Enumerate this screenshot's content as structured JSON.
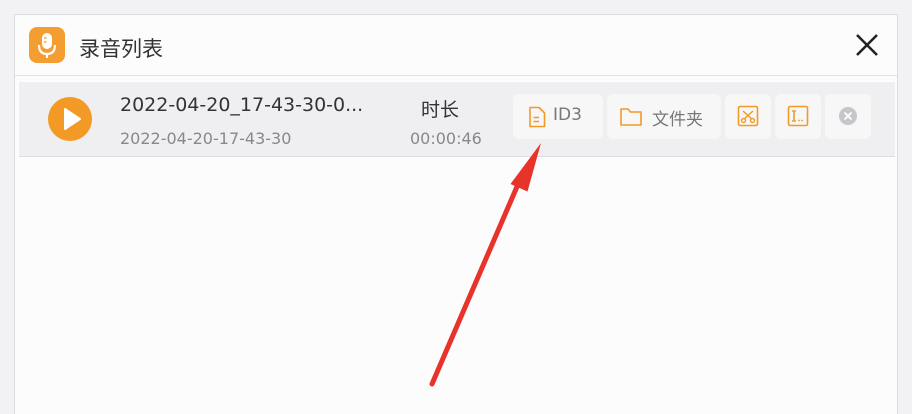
{
  "window": {
    "title": "录音列表",
    "app_icon": "microphone-icon",
    "close_icon": "close-icon"
  },
  "recordings": [
    {
      "name": "2022-04-20_17-43-30-0...",
      "date": "2022-04-20-17-43-30",
      "duration_label": "时长",
      "duration": "00:00:46",
      "actions": {
        "id3_label": "ID3",
        "folder_label": "文件夹",
        "id3_icon": "document-icon",
        "folder_icon": "folder-icon",
        "cut_icon": "scissors-icon",
        "info_icon": "text-cursor-icon",
        "delete_icon": "delete-circle-icon"
      }
    }
  ],
  "colors": {
    "accent": "#f39a26",
    "annotation_arrow": "#e8332a"
  }
}
